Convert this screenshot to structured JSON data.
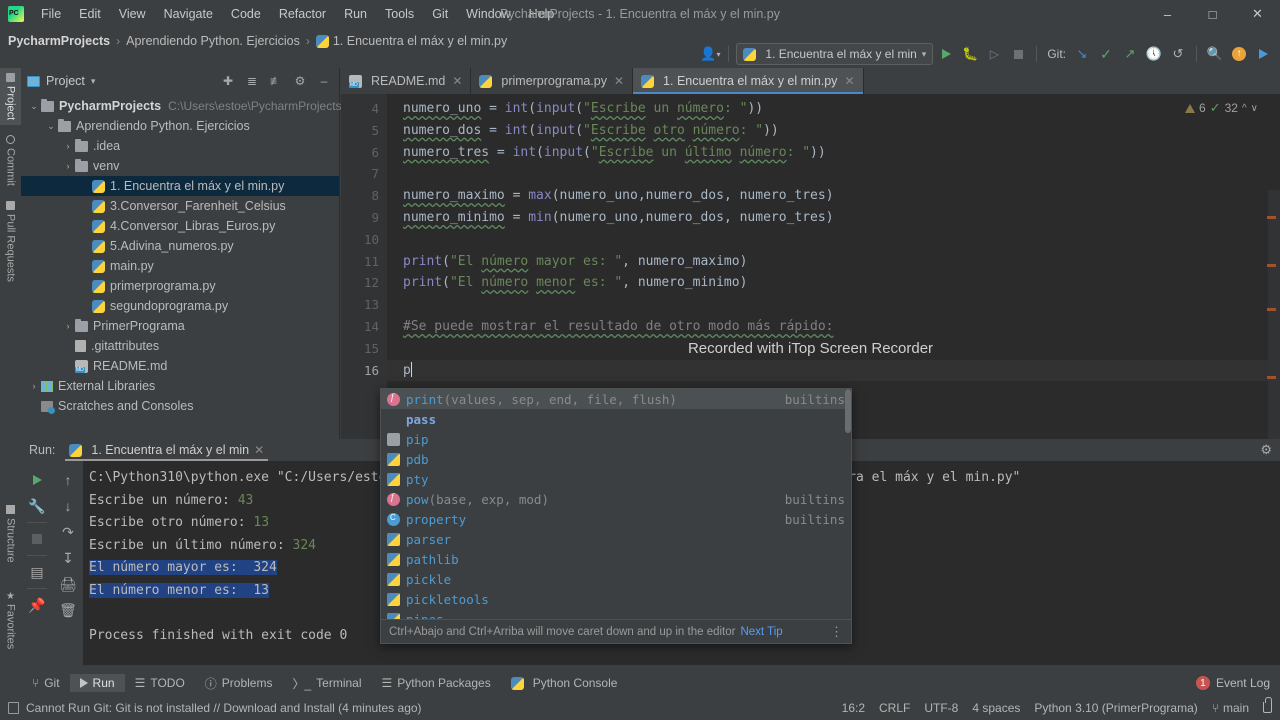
{
  "window": {
    "title": "PycharmProjects - 1. Encuentra el máx y el min.py",
    "logo": "pycharm-logo",
    "controls": {
      "minimize": "–",
      "maximize": "□",
      "close": "✕"
    }
  },
  "menubar": {
    "items": [
      "File",
      "Edit",
      "View",
      "Navigate",
      "Code",
      "Refactor",
      "Run",
      "Tools",
      "Git",
      "Window",
      "Help"
    ]
  },
  "breadcrumb": {
    "items": [
      "PycharmProjects",
      "Aprendiendo Python. Ejercicios",
      "1. Encuentra el máx y el min.py"
    ],
    "separator": "›"
  },
  "toolbar": {
    "run_config": "1. Encuentra el máx y el min",
    "git_label": "Git:",
    "icons": [
      "user-avatar-icon",
      "run-icon",
      "debug-icon",
      "run-coverage-icon",
      "stop-icon",
      "git-update-icon",
      "git-commit-icon",
      "git-push-icon",
      "history-icon",
      "undo-icon",
      "search-icon",
      "updates-icon",
      "ide-icon"
    ]
  },
  "left_strips": {
    "top": [
      "Project",
      "Commit",
      "Pull Requests"
    ],
    "bottom": [
      "Structure",
      "Favorites"
    ],
    "active": "Project"
  },
  "project_panel": {
    "title": "Project",
    "header_icons": [
      "locate-icon",
      "expand-all-icon",
      "collapse-all-icon",
      "settings-icon",
      "hide-icon"
    ],
    "tree": [
      {
        "label": "PycharmProjects",
        "path": "C:\\Users\\estoe\\PycharmProjects",
        "indent": 0,
        "arrow": "⌄",
        "icon": "folder",
        "bold": true,
        "selected": false
      },
      {
        "label": "Aprendiendo Python. Ejercicios",
        "path": "",
        "indent": 1,
        "arrow": "⌄",
        "icon": "folder",
        "bold": false,
        "selected": false
      },
      {
        "label": ".idea",
        "path": "",
        "indent": 2,
        "arrow": "›",
        "icon": "folder",
        "bold": false,
        "selected": false
      },
      {
        "label": "venv",
        "path": "",
        "indent": 2,
        "arrow": "›",
        "icon": "folder",
        "bold": false,
        "selected": false
      },
      {
        "label": "1. Encuentra el máx y el min.py",
        "path": "",
        "indent": 3,
        "arrow": "",
        "icon": "python",
        "bold": false,
        "selected": true
      },
      {
        "label": "3.Conversor_Farenheit_Celsius",
        "path": "",
        "indent": 3,
        "arrow": "",
        "icon": "python",
        "bold": false,
        "selected": false
      },
      {
        "label": "4.Conversor_Libras_Euros.py",
        "path": "",
        "indent": 3,
        "arrow": "",
        "icon": "python",
        "bold": false,
        "selected": false
      },
      {
        "label": "5.Adivina_numeros.py",
        "path": "",
        "indent": 3,
        "arrow": "",
        "icon": "python",
        "bold": false,
        "selected": false
      },
      {
        "label": "main.py",
        "path": "",
        "indent": 3,
        "arrow": "",
        "icon": "python",
        "bold": false,
        "selected": false
      },
      {
        "label": "primerprograma.py",
        "path": "",
        "indent": 3,
        "arrow": "",
        "icon": "python",
        "bold": false,
        "selected": false
      },
      {
        "label": "segundoprograma.py",
        "path": "",
        "indent": 3,
        "arrow": "",
        "icon": "python",
        "bold": false,
        "selected": false
      },
      {
        "label": "PrimerPrograma",
        "path": "",
        "indent": 2,
        "arrow": "›",
        "icon": "folder",
        "bold": false,
        "selected": false
      },
      {
        "label": ".gitattributes",
        "path": "",
        "indent": 2,
        "arrow": "",
        "icon": "file",
        "bold": false,
        "selected": false
      },
      {
        "label": "README.md",
        "path": "",
        "indent": 2,
        "arrow": "",
        "icon": "markdown",
        "bold": false,
        "selected": false
      },
      {
        "label": "External Libraries",
        "path": "",
        "indent": 0,
        "arrow": "›",
        "icon": "library",
        "bold": false,
        "selected": false
      },
      {
        "label": "Scratches and Consoles",
        "path": "",
        "indent": 0,
        "arrow": "",
        "icon": "scratch",
        "bold": false,
        "selected": false
      }
    ]
  },
  "editor": {
    "tabs": [
      {
        "label": "README.md",
        "icon": "markdown",
        "active": false
      },
      {
        "label": "primerprograma.py",
        "icon": "python",
        "active": false
      },
      {
        "label": "1. Encuentra el máx y el min.py",
        "icon": "python",
        "active": true
      }
    ],
    "line_numbers": [
      "4",
      "5",
      "6",
      "7",
      "8",
      "9",
      "10",
      "11",
      "12",
      "13",
      "14",
      "15",
      "16"
    ],
    "current_line": "16",
    "code_lines": [
      "numero_uno = int(input(\"Escribe un número: \"))",
      "numero_dos = int(input(\"Escribe otro número: \"))",
      "numero_tres = int(input(\"Escribe un último número: \"))",
      "",
      "numero_maximo = max(numero_uno,numero_dos, numero_tres)",
      "numero_minimo = min(numero_uno,numero_dos, numero_tres)",
      "",
      "print(\"El número mayor es: \", numero_maximo)",
      "print(\"El número menor es: \", numero_minimo)",
      "",
      "#Se puede mostrar el resultado de otro modo más rápido:",
      "",
      "p"
    ],
    "watermark": "Recorded with iTop Screen Recorder",
    "inspection": {
      "warnings": "6",
      "checks": "32"
    }
  },
  "autocomplete": {
    "items": [
      {
        "name": "print",
        "signature": "(values, sep, end, file, flush)",
        "tail": "builtins",
        "icon": "function-icon",
        "selected": true
      },
      {
        "name": "pass",
        "signature": "",
        "tail": "",
        "icon": "keyword-icon",
        "selected": false
      },
      {
        "name": "pip",
        "signature": "",
        "tail": "",
        "icon": "directory-icon",
        "selected": false
      },
      {
        "name": "pdb",
        "signature": "",
        "tail": "",
        "icon": "python-module-icon",
        "selected": false
      },
      {
        "name": "pty",
        "signature": "",
        "tail": "",
        "icon": "python-module-icon",
        "selected": false
      },
      {
        "name": "pow",
        "signature": "(base, exp, mod)",
        "tail": "builtins",
        "icon": "function-icon",
        "selected": false
      },
      {
        "name": "property",
        "signature": "",
        "tail": "builtins",
        "icon": "class-icon",
        "selected": false
      },
      {
        "name": "parser",
        "signature": "",
        "tail": "",
        "icon": "python-module-icon",
        "selected": false
      },
      {
        "name": "pathlib",
        "signature": "",
        "tail": "",
        "icon": "python-module-icon",
        "selected": false
      },
      {
        "name": "pickle",
        "signature": "",
        "tail": "",
        "icon": "python-module-icon",
        "selected": false
      },
      {
        "name": "pickletools",
        "signature": "",
        "tail": "",
        "icon": "python-module-icon",
        "selected": false
      },
      {
        "name": "pipes",
        "signature": "",
        "tail": "",
        "icon": "python-module-icon",
        "selected": false
      }
    ],
    "footer_hint": "Ctrl+Abajo and Ctrl+Arriba will move caret down and up in the editor",
    "footer_link": "Next Tip"
  },
  "run_panel": {
    "label": "Run:",
    "tab": "1. Encuentra el máx y el min",
    "tool_icons_left": [
      "rerun-icon",
      "settings-wrench-icon",
      "stop-icon",
      "layout-icon",
      "pin-icon"
    ],
    "tool_icons_right": [
      "scroll-up-icon",
      "scroll-down-icon",
      "soft-wrap-icon",
      "scroll-to-end-icon",
      "print-icon",
      "clear-all-icon"
    ],
    "console": [
      {
        "text": "C:\\Python310\\python.exe \"C:/Users/estoe/PycharmProjects/Aprendiendo Python. Ejercicios/1. Encuentra el máx y el min.py\"",
        "style": "plain"
      },
      {
        "prompt": "Escribe un número: ",
        "value": "43",
        "style": "input"
      },
      {
        "prompt": "Escribe otro número: ",
        "value": "13",
        "style": "input"
      },
      {
        "prompt": "Escribe un último número: ",
        "value": "324",
        "style": "input"
      },
      {
        "text": "El número mayor es:  324",
        "style": "highlight"
      },
      {
        "text": "El número menor es:  13",
        "style": "highlight"
      },
      {
        "text": "",
        "style": "plain"
      },
      {
        "text": "Process finished with exit code 0",
        "style": "plain"
      }
    ]
  },
  "toolwindow_bar": {
    "items": [
      {
        "label": "Git",
        "icon": "git-branch-icon",
        "active": false
      },
      {
        "label": "Run",
        "icon": "run-icon",
        "active": true
      },
      {
        "label": "TODO",
        "icon": "todo-icon",
        "active": false
      },
      {
        "label": "Problems",
        "icon": "problems-icon",
        "active": false
      },
      {
        "label": "Terminal",
        "icon": "terminal-icon",
        "active": false
      },
      {
        "label": "Python Packages",
        "icon": "packages-icon",
        "active": false
      },
      {
        "label": "Python Console",
        "icon": "python-console-icon",
        "active": false
      }
    ],
    "event_log": {
      "label": "Event Log",
      "count": "1"
    }
  },
  "statusbar": {
    "message": "Cannot Run Git: Git is not installed // Download and Install (4 minutes ago)",
    "caret_position": "16:2",
    "line_separator": "CRLF",
    "encoding": "UTF-8",
    "indent": "4 spaces",
    "interpreter": "Python 3.10 (PrimerPrograma)",
    "branch": "main",
    "lock": "lock-icon"
  }
}
